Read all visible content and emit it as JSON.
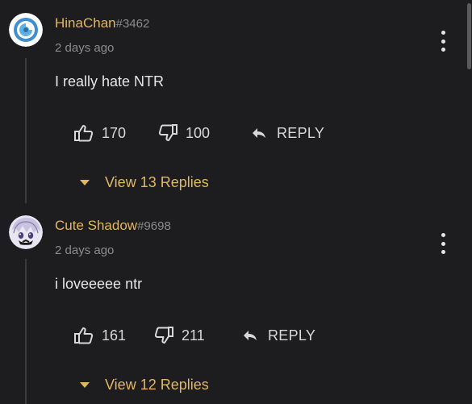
{
  "comments": [
    {
      "username": "HinaChan",
      "discriminator": "#3462",
      "time": "2 days ago",
      "body": "I really hate NTR",
      "likes": "170",
      "dislikes": "100",
      "reply_label": "REPLY",
      "view_replies": "View 13 Replies"
    },
    {
      "username": "Cute Shadow",
      "discriminator": "#9698",
      "time": "2 days ago",
      "body": "i loveeeee ntr",
      "likes": "161",
      "dislikes": "211",
      "reply_label": "REPLY",
      "view_replies": "View 12 Replies"
    }
  ],
  "colors": {
    "background": "#1d1d1f",
    "username": "#e3b85d",
    "muted": "#8c8c8c",
    "accent": "#e3b85d"
  },
  "icons": [
    "thumbs-up-icon",
    "thumbs-down-icon",
    "reply-arrow-icon",
    "more-vertical-icon",
    "caret-down-icon"
  ]
}
